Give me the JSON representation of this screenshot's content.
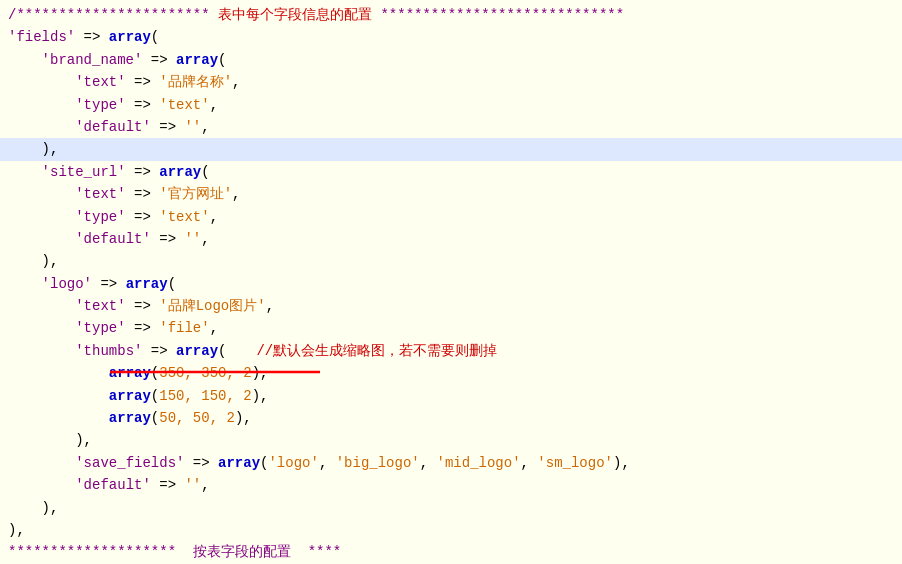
{
  "code": {
    "lines": [
      {
        "id": 1,
        "content": "/*********************** 表中每个字段信息的配置 ********************************",
        "highlighted": false,
        "segments": [
          {
            "text": "/*********************** ",
            "class": "c-comment"
          },
          {
            "text": "表中每个字段信息的配置",
            "class": "c-red"
          },
          {
            "text": " ********************************",
            "class": "c-comment"
          }
        ]
      },
      {
        "id": 2,
        "content": "'fields' => array(",
        "highlighted": false,
        "segments": [
          {
            "text": "'fields'",
            "class": "c-purple"
          },
          {
            "text": " => ",
            "class": "c-black"
          },
          {
            "text": "array",
            "class": "c-blue"
          },
          {
            "text": "(",
            "class": "c-black"
          }
        ]
      },
      {
        "id": 3,
        "content": "    'brand_name' => array(",
        "highlighted": false,
        "segments": [
          {
            "text": "    ",
            "class": "c-black"
          },
          {
            "text": "'brand_name'",
            "class": "c-purple"
          },
          {
            "text": " => ",
            "class": "c-black"
          },
          {
            "text": "array",
            "class": "c-blue"
          },
          {
            "text": "(",
            "class": "c-black"
          }
        ]
      },
      {
        "id": 4,
        "content": "        'text' => '品牌名称',",
        "highlighted": false,
        "segments": [
          {
            "text": "        ",
            "class": "c-black"
          },
          {
            "text": "'text'",
            "class": "c-purple"
          },
          {
            "text": " => ",
            "class": "c-black"
          },
          {
            "text": "'品牌名称'",
            "class": "c-orange"
          },
          {
            "text": ",",
            "class": "c-black"
          }
        ]
      },
      {
        "id": 5,
        "content": "        'type' => 'text',",
        "highlighted": false,
        "segments": [
          {
            "text": "        ",
            "class": "c-black"
          },
          {
            "text": "'type'",
            "class": "c-purple"
          },
          {
            "text": " => ",
            "class": "c-black"
          },
          {
            "text": "'text'",
            "class": "c-orange"
          },
          {
            "text": ",",
            "class": "c-black"
          }
        ]
      },
      {
        "id": 6,
        "content": "        'default' => '',",
        "highlighted": false,
        "segments": [
          {
            "text": "        ",
            "class": "c-black"
          },
          {
            "text": "'default'",
            "class": "c-purple"
          },
          {
            "text": " => ",
            "class": "c-black"
          },
          {
            "text": "''",
            "class": "c-orange"
          },
          {
            "text": ",",
            "class": "c-black"
          }
        ]
      },
      {
        "id": 7,
        "content": "    ),",
        "highlighted": true,
        "segments": [
          {
            "text": "    ),",
            "class": "c-black"
          }
        ]
      },
      {
        "id": 8,
        "content": "    'site_url' => array(",
        "highlighted": false,
        "segments": [
          {
            "text": "    ",
            "class": "c-black"
          },
          {
            "text": "'site_url'",
            "class": "c-purple"
          },
          {
            "text": " => ",
            "class": "c-black"
          },
          {
            "text": "array",
            "class": "c-blue"
          },
          {
            "text": "(",
            "class": "c-black"
          }
        ]
      },
      {
        "id": 9,
        "content": "        'text' => '官方网址',",
        "highlighted": false,
        "segments": [
          {
            "text": "        ",
            "class": "c-black"
          },
          {
            "text": "'text'",
            "class": "c-purple"
          },
          {
            "text": " => ",
            "class": "c-black"
          },
          {
            "text": "'官方网址'",
            "class": "c-orange"
          },
          {
            "text": ",",
            "class": "c-black"
          }
        ]
      },
      {
        "id": 10,
        "content": "        'type' => 'text',",
        "highlighted": false,
        "segments": [
          {
            "text": "        ",
            "class": "c-black"
          },
          {
            "text": "'type'",
            "class": "c-purple"
          },
          {
            "text": " => ",
            "class": "c-black"
          },
          {
            "text": "'text'",
            "class": "c-orange"
          },
          {
            "text": ",",
            "class": "c-black"
          }
        ]
      },
      {
        "id": 11,
        "content": "        'default' => '',",
        "highlighted": false,
        "segments": [
          {
            "text": "        ",
            "class": "c-black"
          },
          {
            "text": "'default'",
            "class": "c-purple"
          },
          {
            "text": " => ",
            "class": "c-black"
          },
          {
            "text": "''",
            "class": "c-orange"
          },
          {
            "text": ",",
            "class": "c-black"
          }
        ]
      },
      {
        "id": 12,
        "content": "    ),",
        "highlighted": false,
        "segments": [
          {
            "text": "    ),",
            "class": "c-black"
          }
        ]
      },
      {
        "id": 13,
        "content": "    'logo' => array(",
        "highlighted": false,
        "segments": [
          {
            "text": "    ",
            "class": "c-black"
          },
          {
            "text": "'logo'",
            "class": "c-purple"
          },
          {
            "text": " => ",
            "class": "c-black"
          },
          {
            "text": "array",
            "class": "c-blue"
          },
          {
            "text": "(",
            "class": "c-black"
          }
        ]
      },
      {
        "id": 14,
        "content": "        'text' => '品牌Logo图片',",
        "highlighted": false,
        "segments": [
          {
            "text": "        ",
            "class": "c-black"
          },
          {
            "text": "'text'",
            "class": "c-purple"
          },
          {
            "text": " => ",
            "class": "c-black"
          },
          {
            "text": "'品牌Logo图片'",
            "class": "c-orange"
          },
          {
            "text": ",",
            "class": "c-black"
          }
        ]
      },
      {
        "id": 15,
        "content": "        'type' => 'file',",
        "highlighted": false,
        "segments": [
          {
            "text": "        ",
            "class": "c-black"
          },
          {
            "text": "'type'",
            "class": "c-purple"
          },
          {
            "text": " => ",
            "class": "c-black"
          },
          {
            "text": "'file'",
            "class": "c-orange"
          },
          {
            "text": ",",
            "class": "c-black"
          }
        ]
      },
      {
        "id": 16,
        "content": "        'thumbs' => array(    //默认会生成缩略图，若不需要则删掉",
        "highlighted": false,
        "segments": [
          {
            "text": "        ",
            "class": "c-black"
          },
          {
            "text": "'thumbs'",
            "class": "c-purple"
          },
          {
            "text": " => ",
            "class": "c-black"
          },
          {
            "text": "array",
            "class": "c-blue"
          },
          {
            "text": "(",
            "class": "c-black"
          },
          {
            "text": "    //默认会生成缩略图，若不需要则删掉",
            "class": "c-chinese-comment"
          }
        ]
      },
      {
        "id": 17,
        "content": "            array(350, 350, 2),",
        "highlighted": false,
        "segments": [
          {
            "text": "            ",
            "class": "c-black"
          },
          {
            "text": "array",
            "class": "c-blue"
          },
          {
            "text": "(",
            "class": "c-black"
          },
          {
            "text": "350, 350, 2",
            "class": "c-orange"
          },
          {
            "text": "),",
            "class": "c-black"
          }
        ]
      },
      {
        "id": 18,
        "content": "            array(150, 150, 2),",
        "highlighted": false,
        "segments": [
          {
            "text": "            ",
            "class": "c-black"
          },
          {
            "text": "array",
            "class": "c-blue"
          },
          {
            "text": "(",
            "class": "c-black"
          },
          {
            "text": "150, 150, 2",
            "class": "c-orange"
          },
          {
            "text": "),",
            "class": "c-black"
          }
        ]
      },
      {
        "id": 19,
        "content": "            array(50, 50, 2),",
        "highlighted": false,
        "segments": [
          {
            "text": "            ",
            "class": "c-black"
          },
          {
            "text": "array",
            "class": "c-blue"
          },
          {
            "text": "(",
            "class": "c-black"
          },
          {
            "text": "50, 50, 2",
            "class": "c-orange"
          },
          {
            "text": "),",
            "class": "c-black"
          }
        ]
      },
      {
        "id": 20,
        "content": "        ),",
        "highlighted": false,
        "segments": [
          {
            "text": "        ),",
            "class": "c-black"
          }
        ]
      },
      {
        "id": 21,
        "content": "        'save_fields' => array('logo', 'big_logo', 'mid_logo', 'sm_logo'),",
        "highlighted": false,
        "segments": [
          {
            "text": "        ",
            "class": "c-black"
          },
          {
            "text": "'save_fields'",
            "class": "c-purple"
          },
          {
            "text": " => ",
            "class": "c-black"
          },
          {
            "text": "array",
            "class": "c-blue"
          },
          {
            "text": "(",
            "class": "c-black"
          },
          {
            "text": "'logo'",
            "class": "c-orange"
          },
          {
            "text": ", ",
            "class": "c-black"
          },
          {
            "text": "'big_logo'",
            "class": "c-orange"
          },
          {
            "text": ", ",
            "class": "c-black"
          },
          {
            "text": "'mid_logo'",
            "class": "c-orange"
          },
          {
            "text": ", ",
            "class": "c-black"
          },
          {
            "text": "'sm_logo'",
            "class": "c-orange"
          },
          {
            "text": "),",
            "class": "c-black"
          }
        ]
      },
      {
        "id": 22,
        "content": "        'default' => '',",
        "highlighted": false,
        "segments": [
          {
            "text": "        ",
            "class": "c-black"
          },
          {
            "text": "'default'",
            "class": "c-purple"
          },
          {
            "text": " => ",
            "class": "c-black"
          },
          {
            "text": "''",
            "class": "c-orange"
          },
          {
            "text": ",",
            "class": "c-black"
          }
        ]
      },
      {
        "id": 23,
        "content": "    ),",
        "highlighted": false,
        "segments": [
          {
            "text": "    ),",
            "class": "c-black"
          }
        ]
      },
      {
        "id": 24,
        "content": "),",
        "highlighted": false,
        "segments": [
          {
            "text": "),",
            "class": "c-black"
          }
        ]
      },
      {
        "id": 25,
        "content": "********************  按表字段的配置  ****",
        "highlighted": false,
        "segments": [
          {
            "text": "********************  按表字段的配置  ****",
            "class": "c-comment"
          }
        ]
      }
    ],
    "annotation": {
      "text": "//默认会生成缩略图，若不需要则删掉",
      "arrow_start": "thumbs array label",
      "underline_color": "#ff0000"
    }
  }
}
